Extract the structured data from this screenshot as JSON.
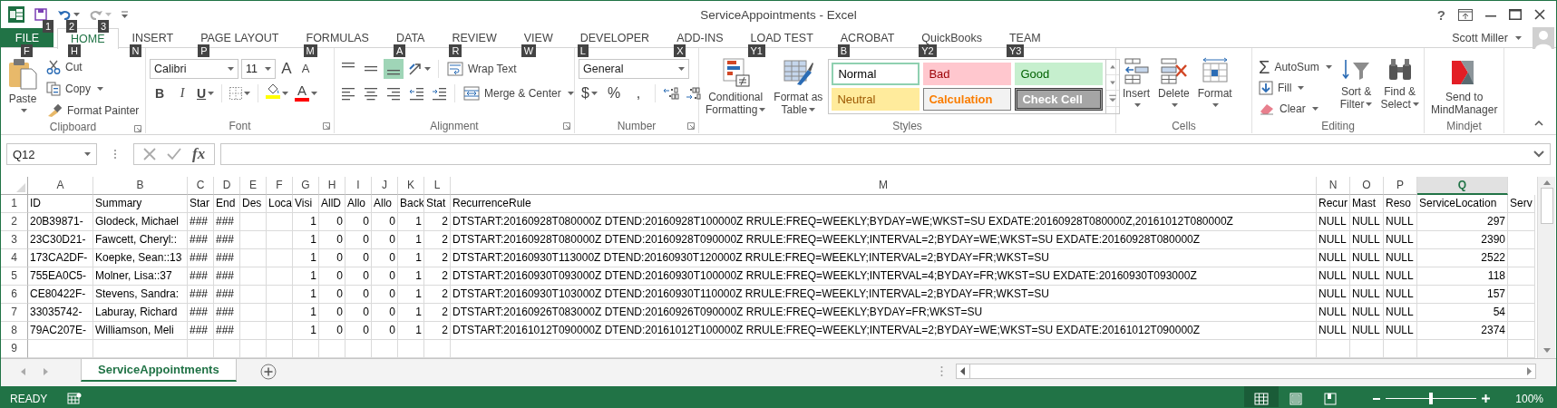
{
  "window": {
    "title": "ServiceAppointments - Excel",
    "user": "Scott Miller",
    "help": "?"
  },
  "quick_access": [
    {
      "kind": "save",
      "keytip": "1",
      "disabled": false,
      "dropdown": false
    },
    {
      "kind": "undo",
      "keytip": "2",
      "disabled": false,
      "dropdown": true
    },
    {
      "kind": "redo",
      "keytip": "3",
      "disabled": true,
      "dropdown": true
    }
  ],
  "tabs": [
    {
      "label": "FILE",
      "keytip": "F",
      "kind": "file",
      "selected": false
    },
    {
      "label": "HOME",
      "keytip": "H",
      "kind": "tab",
      "selected": true
    },
    {
      "label": "INSERT",
      "keytip": "N",
      "kind": "tab",
      "selected": false
    },
    {
      "label": "PAGE LAYOUT",
      "keytip": "P",
      "kind": "tab",
      "selected": false
    },
    {
      "label": "FORMULAS",
      "keytip": "M",
      "kind": "tab",
      "selected": false
    },
    {
      "label": "DATA",
      "keytip": "A",
      "kind": "tab",
      "selected": false
    },
    {
      "label": "REVIEW",
      "keytip": "R",
      "kind": "tab",
      "selected": false
    },
    {
      "label": "VIEW",
      "keytip": "W",
      "kind": "tab",
      "selected": false
    },
    {
      "label": "DEVELOPER",
      "keytip": "L",
      "kind": "tab",
      "selected": false
    },
    {
      "label": "ADD-INS",
      "keytip": "X",
      "kind": "tab",
      "selected": false
    },
    {
      "label": "LOAD TEST",
      "keytip": "Y1",
      "kind": "tab",
      "selected": false
    },
    {
      "label": "ACROBAT",
      "keytip": "B",
      "kind": "tab",
      "selected": false
    },
    {
      "label": "QuickBooks",
      "keytip": "Y2",
      "kind": "tab",
      "selected": false
    },
    {
      "label": "TEAM",
      "keytip": "Y3",
      "kind": "tab",
      "selected": false
    }
  ],
  "ribbon": {
    "groups": [
      {
        "kind": "clipboard",
        "label": "Clipboard",
        "launcher": true,
        "large": {
          "lines": [
            "Paste"
          ],
          "kind": "paste",
          "dropdown": true
        },
        "small": [
          {
            "label": "Cut",
            "kind": "cut",
            "dropdown": false
          },
          {
            "label": "Copy",
            "kind": "copy",
            "dropdown": true
          },
          {
            "label": "Format Painter",
            "kind": "format_painter",
            "dropdown": false
          }
        ]
      },
      {
        "kind": "font",
        "label": "Font",
        "launcher": true,
        "font_name": "Calibri",
        "font_size": "11",
        "size_buttons": [
          {
            "glyph": "A",
            "kind": "grow"
          },
          {
            "glyph": "A",
            "kind": "shrink"
          }
        ],
        "format_buttons": [
          {
            "glyph": "B",
            "kind": "bold",
            "dropdown": false
          },
          {
            "glyph": "I",
            "kind": "italic",
            "dropdown": false
          },
          {
            "glyph": "U",
            "kind": "underline",
            "dropdown": true
          }
        ],
        "color_buttons": [
          {
            "kind": "fill",
            "color": "#ffff00"
          },
          {
            "kind": "font_color",
            "glyph": "A",
            "color": "#ff0000"
          }
        ]
      },
      {
        "kind": "alignment",
        "label": "Alignment",
        "launcher": true,
        "vertical": [
          {
            "kind": "top",
            "selected": false
          },
          {
            "kind": "middle",
            "selected": false
          },
          {
            "kind": "bottom",
            "selected": true
          }
        ],
        "horizontal": [
          {
            "kind": "left",
            "selected": false
          },
          {
            "kind": "center",
            "selected": false
          },
          {
            "kind": "right",
            "selected": false
          }
        ],
        "wrap": "Wrap Text",
        "merge": "Merge & Center"
      },
      {
        "kind": "number",
        "label": "Number",
        "launcher": true,
        "format": "General",
        "symbols": [
          {
            "glyph": "$",
            "dropdown": true
          },
          {
            "glyph": "%",
            "dropdown": false
          },
          {
            "glyph": ",",
            "dropdown": false
          }
        ]
      },
      {
        "kind": "styles",
        "label": "Styles",
        "launcher": false,
        "large": [
          {
            "lines": [
              "Conditional",
              "Formatting"
            ],
            "kind": "conditional",
            "dropdown": true
          },
          {
            "lines": [
              "Format as",
              "Table"
            ],
            "kind": "table",
            "dropdown": true
          }
        ],
        "cell_styles": [
          {
            "label": "Normal",
            "kind": "normal",
            "selected": true
          },
          {
            "label": "Bad",
            "kind": "bad",
            "selected": false
          },
          {
            "label": "Good",
            "kind": "good",
            "selected": false
          },
          {
            "label": "Neutral",
            "kind": "neutral",
            "selected": false
          },
          {
            "label": "Calculation",
            "kind": "calculation",
            "selected": false
          },
          {
            "label": "Check Cell",
            "kind": "check",
            "selected": false
          }
        ]
      },
      {
        "kind": "cells",
        "label": "Cells",
        "launcher": false,
        "large": [
          {
            "lines": [
              "Insert"
            ],
            "kind": "insert",
            "dropdown": true
          },
          {
            "lines": [
              "Delete"
            ],
            "kind": "delete",
            "dropdown": true
          },
          {
            "lines": [
              "Format"
            ],
            "kind": "format",
            "dropdown": true
          }
        ]
      },
      {
        "kind": "editing",
        "label": "Editing",
        "launcher": false,
        "small": [
          {
            "label": "AutoSum",
            "kind": "sum",
            "glyph": "Σ",
            "dropdown": true
          },
          {
            "label": "Fill",
            "kind": "fill_down",
            "dropdown": true
          },
          {
            "label": "Clear",
            "kind": "clear",
            "dropdown": true
          }
        ],
        "large": [
          {
            "lines": [
              "Sort &",
              "Filter"
            ],
            "kind": "sort",
            "dropdown": true
          },
          {
            "lines": [
              "Find &",
              "Select"
            ],
            "kind": "find",
            "dropdown": true
          }
        ]
      },
      {
        "kind": "cells",
        "label": "Mindjet",
        "launcher": false,
        "large": [
          {
            "lines": [
              "Send to",
              "MindManager"
            ],
            "kind": "mindmanager",
            "dropdown": false
          }
        ]
      }
    ]
  },
  "formula_bar": {
    "name_box": "Q12",
    "fx": "fx"
  },
  "sheet": {
    "columns": [
      {
        "letter": "A",
        "kind": "text",
        "selected": false
      },
      {
        "letter": "B",
        "kind": "text",
        "selected": false
      },
      {
        "letter": "C",
        "kind": "text",
        "selected": false
      },
      {
        "letter": "D",
        "kind": "text",
        "selected": false
      },
      {
        "letter": "E",
        "kind": "text",
        "selected": false
      },
      {
        "letter": "F",
        "kind": "text",
        "selected": false
      },
      {
        "letter": "G",
        "kind": "number",
        "selected": false
      },
      {
        "letter": "H",
        "kind": "number",
        "selected": false
      },
      {
        "letter": "I",
        "kind": "number",
        "selected": false
      },
      {
        "letter": "J",
        "kind": "number",
        "selected": false
      },
      {
        "letter": "K",
        "kind": "number",
        "selected": false
      },
      {
        "letter": "L",
        "kind": "number",
        "selected": false
      },
      {
        "letter": "M",
        "kind": "text",
        "selected": false
      },
      {
        "letter": "N",
        "kind": "text",
        "selected": false
      },
      {
        "letter": "O",
        "kind": "text",
        "selected": false
      },
      {
        "letter": "P",
        "kind": "text",
        "selected": false
      },
      {
        "letter": "Q",
        "kind": "number",
        "selected": true
      }
    ],
    "rows": [
      {
        "number": "1",
        "kind": "header",
        "cells": [
          "ID",
          "Summary",
          "Star",
          "End",
          "Des",
          "Loca",
          "Visi",
          "AllD",
          "Allo",
          "Allo",
          "Back",
          "Stat",
          "RecurrenceRule",
          "Recur",
          "Mast",
          "Reso",
          "ServiceLocation",
          "Serv"
        ]
      },
      {
        "number": "2",
        "kind": "data",
        "cells": [
          "20B39871-",
          "Glodeck, Michael",
          "###",
          "###",
          null,
          null,
          "1",
          "0",
          "0",
          "0",
          "1",
          "2",
          "DTSTART:20160928T080000Z DTEND:20160928T100000Z RRULE:FREQ=WEEKLY;BYDAY=WE;WKST=SU EXDATE:20160928T080000Z,20161012T080000Z",
          "NULL",
          "NULL",
          "NULL",
          "297",
          null
        ]
      },
      {
        "number": "3",
        "kind": "data",
        "cells": [
          "23C30D21-",
          "Fawcett, Cheryl::",
          "###",
          "###",
          null,
          null,
          "1",
          "0",
          "0",
          "0",
          "1",
          "2",
          "DTSTART:20160928T080000Z DTEND:20160928T090000Z RRULE:FREQ=WEEKLY;INTERVAL=2;BYDAY=WE;WKST=SU EXDATE:20160928T080000Z",
          "NULL",
          "NULL",
          "NULL",
          "2390",
          null
        ]
      },
      {
        "number": "4",
        "kind": "data",
        "cells": [
          "173CA2DF-",
          "Koepke, Sean::13",
          "###",
          "###",
          null,
          null,
          "1",
          "0",
          "0",
          "0",
          "1",
          "2",
          "DTSTART:20160930T113000Z DTEND:20160930T120000Z RRULE:FREQ=WEEKLY;INTERVAL=2;BYDAY=FR;WKST=SU",
          "NULL",
          "NULL",
          "NULL",
          "2522",
          null
        ]
      },
      {
        "number": "5",
        "kind": "data",
        "cells": [
          "755EA0C5-",
          "Molner, Lisa::37",
          "###",
          "###",
          null,
          null,
          "1",
          "0",
          "0",
          "0",
          "1",
          "2",
          "DTSTART:20160930T093000Z DTEND:20160930T100000Z RRULE:FREQ=WEEKLY;INTERVAL=4;BYDAY=FR;WKST=SU EXDATE:20160930T093000Z",
          "NULL",
          "NULL",
          "NULL",
          "118",
          null
        ]
      },
      {
        "number": "6",
        "kind": "data",
        "cells": [
          "CE80422F-",
          "Stevens, Sandra:",
          "###",
          "###",
          null,
          null,
          "1",
          "0",
          "0",
          "0",
          "1",
          "2",
          "DTSTART:20160930T103000Z DTEND:20160930T110000Z RRULE:FREQ=WEEKLY;INTERVAL=2;BYDAY=FR;WKST=SU",
          "NULL",
          "NULL",
          "NULL",
          "157",
          null
        ]
      },
      {
        "number": "7",
        "kind": "data",
        "cells": [
          "33035742-",
          "Laburay, Richard",
          "###",
          "###",
          null,
          null,
          "1",
          "0",
          "0",
          "0",
          "1",
          "2",
          "DTSTART:20160926T083000Z DTEND:20160926T090000Z RRULE:FREQ=WEEKLY;BYDAY=FR;WKST=SU",
          "NULL",
          "NULL",
          "NULL",
          "54",
          null
        ]
      },
      {
        "number": "8",
        "kind": "data",
        "cells": [
          "79AC207E-",
          "Williamson, Meli",
          "###",
          "###",
          null,
          null,
          "1",
          "0",
          "0",
          "0",
          "1",
          "2",
          "DTSTART:20161012T090000Z DTEND:20161012T100000Z RRULE:FREQ=WEEKLY;INTERVAL=2;BYDAY=WE;WKST=SU EXDATE:20161012T090000Z",
          "NULL",
          "NULL",
          "NULL",
          "2374",
          null
        ]
      },
      {
        "number": "9",
        "kind": "data"
      }
    ]
  },
  "sheet_tabs": [
    {
      "label": "ServiceAppointments",
      "selected": true
    }
  ],
  "status_bar": {
    "mode": "READY",
    "views": [
      {
        "kind": "normal",
        "selected": true
      },
      {
        "kind": "page_layout",
        "selected": false
      },
      {
        "kind": "page_break",
        "selected": false
      }
    ],
    "zoom": {
      "level": 0.5,
      "reading": "100%"
    }
  }
}
